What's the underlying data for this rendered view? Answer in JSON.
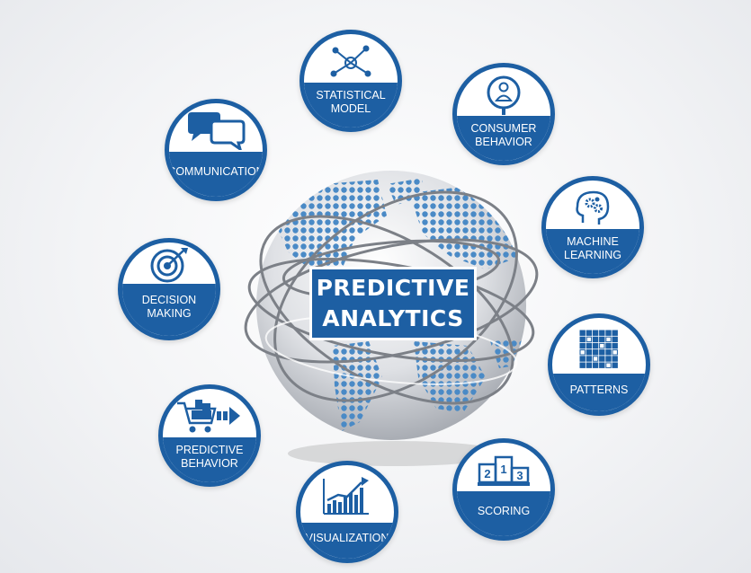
{
  "center": {
    "line1": "PREDICTIVE",
    "line2": "ANALYTICS"
  },
  "colors": {
    "accent": "#1d5fa3",
    "dots": "#4a8ac6",
    "globe": "#c9ccd1"
  },
  "nodes": [
    {
      "id": "statistical-model",
      "lines": [
        "STATISTICAL",
        "MODEL"
      ],
      "icon": "network-icon"
    },
    {
      "id": "consumer-behavior",
      "lines": [
        "CONSUMER",
        "BEHAVIOR"
      ],
      "icon": "user-search-icon"
    },
    {
      "id": "machine-learning",
      "lines": [
        "MACHINE",
        "LEARNING"
      ],
      "icon": "brain-gears-icon"
    },
    {
      "id": "patterns",
      "lines": [
        "PATTERNS"
      ],
      "icon": "grid-pattern-icon"
    },
    {
      "id": "scoring",
      "lines": [
        "SCORING"
      ],
      "icon": "podium-icon"
    },
    {
      "id": "visualization",
      "lines": [
        "VISUALIZATION"
      ],
      "icon": "bar-chart-icon"
    },
    {
      "id": "predictive-behavior",
      "lines": [
        "PREDICTIVE",
        "BEHAVIOR"
      ],
      "icon": "cart-arrow-icon"
    },
    {
      "id": "decision-making",
      "lines": [
        "DECISION",
        "MAKING"
      ],
      "icon": "target-icon"
    },
    {
      "id": "communication",
      "lines": [
        "COMMUNICATION"
      ],
      "icon": "chat-bubbles-icon"
    }
  ],
  "podium": {
    "first": "1",
    "second": "2",
    "third": "3"
  }
}
